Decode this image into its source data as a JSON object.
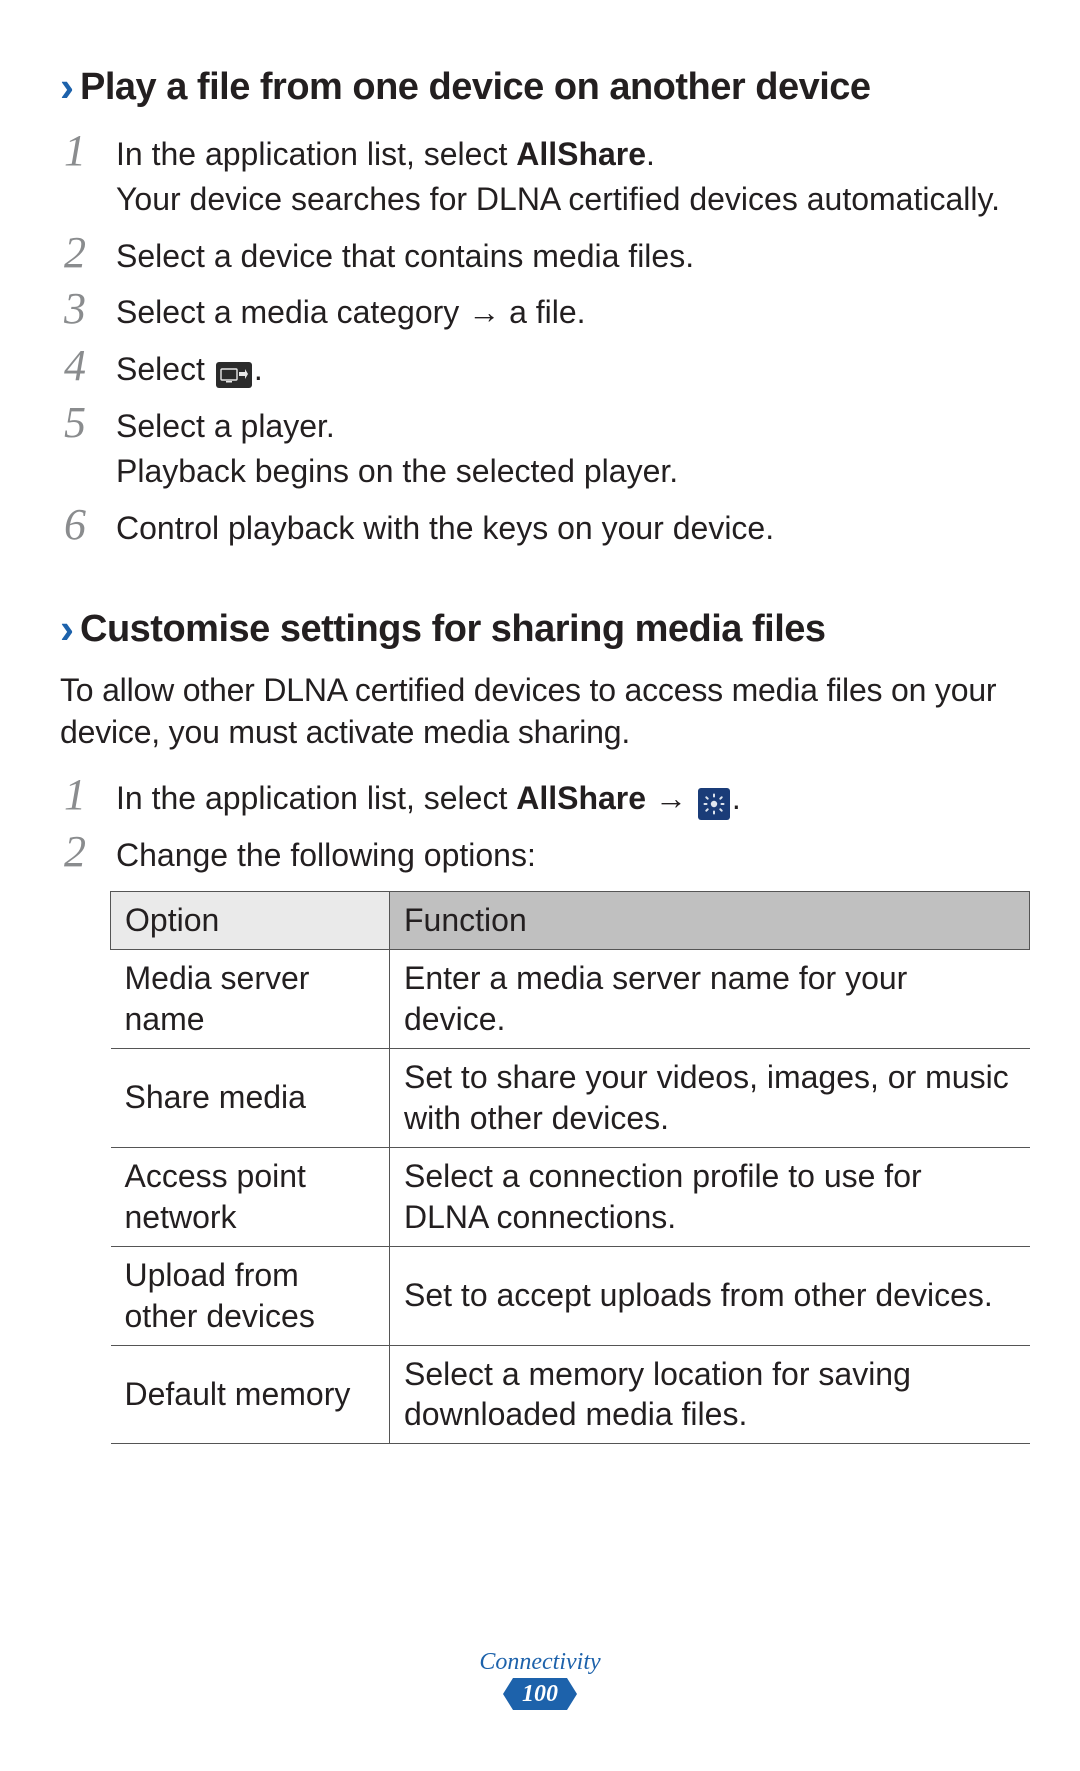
{
  "section1": {
    "heading": "Play a file from one device on another device",
    "steps": [
      {
        "num": "1",
        "lines": [
          {
            "prefix": "In the application list, select ",
            "bold": "AllShare",
            "suffix": "."
          },
          {
            "text": "Your device searches for DLNA certified devices automatically."
          }
        ]
      },
      {
        "num": "2",
        "lines": [
          {
            "text": "Select a device that contains media files."
          }
        ]
      },
      {
        "num": "3",
        "lines": [
          {
            "text": "Select a media category → a file."
          }
        ]
      },
      {
        "num": "4",
        "lines": [
          {
            "prefix": "Select ",
            "icon": "share-to-icon",
            "suffix": "."
          }
        ]
      },
      {
        "num": "5",
        "lines": [
          {
            "text": "Select a player."
          },
          {
            "text": "Playback begins on the selected player."
          }
        ]
      },
      {
        "num": "6",
        "lines": [
          {
            "text": "Control playback with the keys on your device."
          }
        ]
      }
    ]
  },
  "section2": {
    "heading": "Customise settings for sharing media files",
    "intro": "To allow other DLNA certified devices to access media files on your device, you must activate media sharing.",
    "steps": [
      {
        "num": "1",
        "lines": [
          {
            "prefix": "In the application list, select ",
            "bold": "AllShare",
            "suffix": " → ",
            "icon": "gear-icon",
            "suffix2": "."
          }
        ]
      },
      {
        "num": "2",
        "lines": [
          {
            "text": "Change the following options:"
          }
        ]
      }
    ]
  },
  "table": {
    "header": {
      "col1": "Option",
      "col2": "Function"
    },
    "rows": [
      {
        "option": "Media server name",
        "function": "Enter a media server name for your device."
      },
      {
        "option": "Share media",
        "function": "Set to share your videos, images, or music with other devices."
      },
      {
        "option": "Access point network",
        "function": "Select a connection profile to use for DLNA connections."
      },
      {
        "option": "Upload from other devices",
        "function": "Set to accept uploads from other devices."
      },
      {
        "option": "Default memory",
        "function": "Select a memory location for saving downloaded media files."
      }
    ]
  },
  "footer": {
    "section_name": "Connectivity",
    "page_number": "100"
  }
}
